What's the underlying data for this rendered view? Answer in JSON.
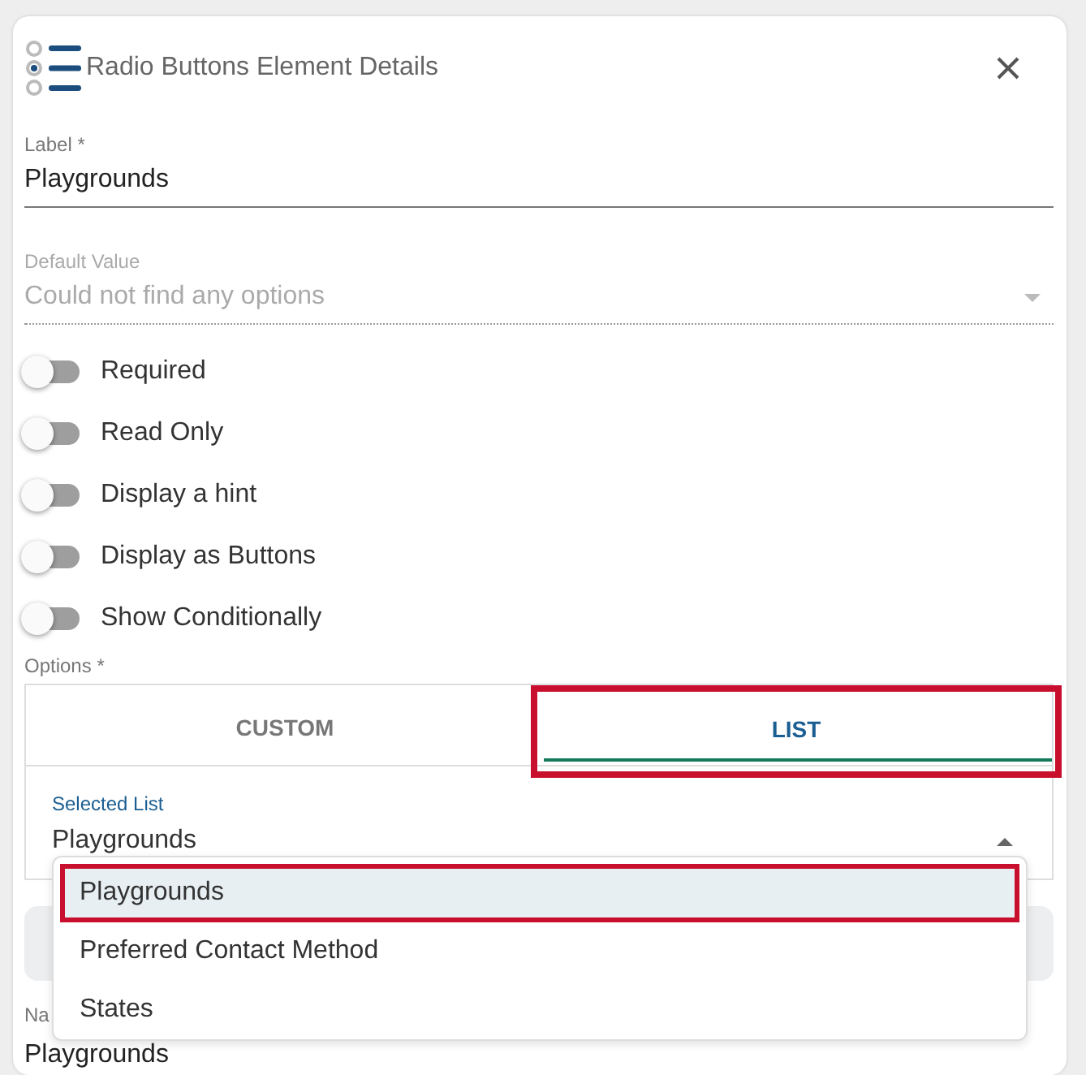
{
  "dialog": {
    "title": "Radio Buttons Element Details"
  },
  "label_field": {
    "label": "Label *",
    "value": "Playgrounds"
  },
  "default_field": {
    "label": "Default Value",
    "placeholder": "Could not find any options",
    "disabled": true
  },
  "toggles": [
    {
      "label": "Required",
      "on": false
    },
    {
      "label": "Read Only",
      "on": false
    },
    {
      "label": "Display a hint",
      "on": false
    },
    {
      "label": "Display as Buttons",
      "on": false
    },
    {
      "label": "Show Conditionally",
      "on": false
    }
  ],
  "options": {
    "label": "Options *",
    "tabs": [
      {
        "label": "CUSTOM",
        "selected": false,
        "highlighted": false
      },
      {
        "label": "LIST",
        "selected": true,
        "highlighted": true
      }
    ],
    "selected_list": {
      "label": "Selected List",
      "value": "Playgrounds",
      "expanded": true,
      "items": [
        {
          "label": "Playgrounds",
          "selected": true,
          "highlighted": true
        },
        {
          "label": "Preferred Contact Method",
          "selected": false,
          "highlighted": false
        },
        {
          "label": "States",
          "selected": false,
          "highlighted": false
        }
      ]
    }
  },
  "name_field": {
    "label": "Na",
    "value": "Playgrounds"
  }
}
